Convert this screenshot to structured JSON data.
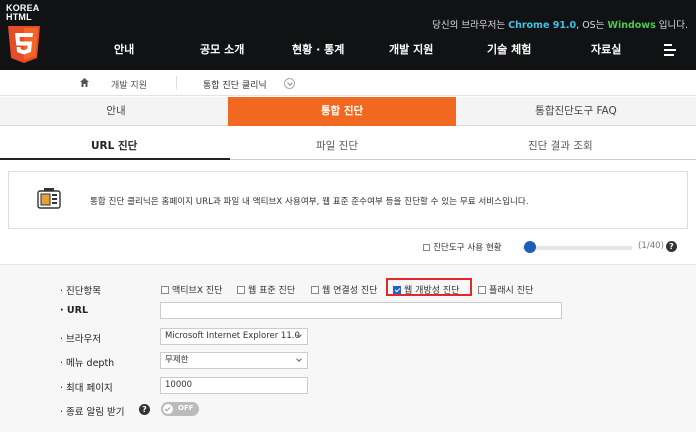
{
  "logo": {
    "line1": "KOREA",
    "line2": "HTML",
    "num": "5"
  },
  "browser_info": {
    "prefix": "당신의 브라우저는 ",
    "browser": "Chrome 91.0",
    "mid": ", OS는 ",
    "os": "Windows",
    "suffix": " 입니다."
  },
  "gnb": [
    "안내",
    "공모 소개",
    "현황 · 통계",
    "개발 지원",
    "기술 체험",
    "자료실"
  ],
  "breadcrumb": {
    "level1": "개발 지원",
    "level2": "통합 진단 클리닉"
  },
  "main_tabs": [
    "안내",
    "통합 진단",
    "통합진단도구 FAQ"
  ],
  "sub_tabs": [
    "URL 진단",
    "파일 진단",
    "진단 결과 조회"
  ],
  "info_text": "통합 진단 클리닉은 홈페이지 URL과 파일 내 액티브X 사용여부, 웹 표준 준수여부 등을 진단할 수 있는 무료 서비스입니다.",
  "usage": {
    "label": "진단도구 사용 현황",
    "count": "(1/40)",
    "progress": 0.025
  },
  "form": {
    "items_label": "· 진단항목",
    "url_label": "· URL",
    "browser_label": "· 브라우저",
    "depth_label": "· 메뉴 depth",
    "maxpage_label": "· 최대 페이지",
    "notify_label": "· 종료 알림 받기",
    "checks": [
      {
        "label": "액티브X 진단",
        "checked": false
      },
      {
        "label": "웹 표준 진단",
        "checked": false
      },
      {
        "label": "웹 연결성 진단",
        "checked": false
      },
      {
        "label": "웹 개방성 진단",
        "checked": true
      },
      {
        "label": "플래시 진단",
        "checked": false
      }
    ],
    "url_value": "",
    "browser_value": "Microsoft Internet Explorer 11.0",
    "depth_value": "무제한",
    "maxpage_value": "10000",
    "toggle_text": "OFF"
  },
  "colors": {
    "accent": "#f16821",
    "header": "#111214",
    "highlight_box": "#e0282d",
    "progress": "#1c5eb8"
  }
}
